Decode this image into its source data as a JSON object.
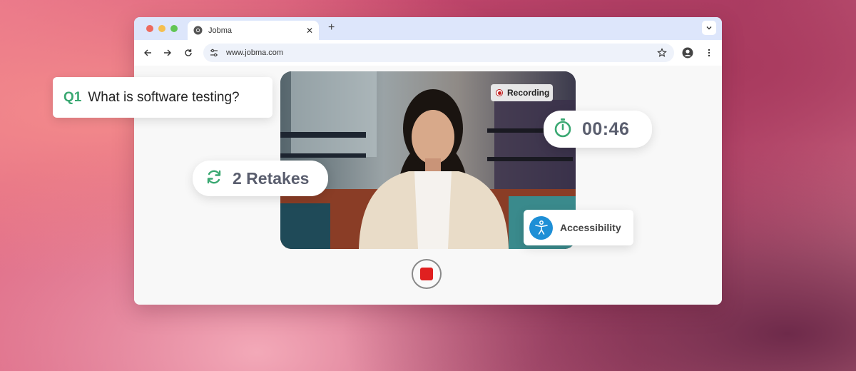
{
  "browser": {
    "tab_title": "Jobma",
    "url": "www.jobma.com"
  },
  "question": {
    "number": "Q1",
    "text": "What is software testing?"
  },
  "recording_label": "Recording",
  "timer": "00:46",
  "retakes": "2 Retakes",
  "accessibility_label": "Accessibility",
  "colors": {
    "accent_green": "#3aa872",
    "record_red": "#e02020",
    "accessibility_blue": "#1e8fd6",
    "tabbar_blue": "#dde6fb"
  },
  "icons": [
    "chrome-icon",
    "close-icon",
    "plus-icon",
    "chevron-down-icon",
    "back-arrow-icon",
    "forward-arrow-icon",
    "reload-icon",
    "site-settings-icon",
    "star-icon",
    "profile-icon",
    "more-vertical-icon",
    "stopwatch-icon",
    "refresh-icon",
    "accessibility-icon",
    "stop-icon"
  ]
}
